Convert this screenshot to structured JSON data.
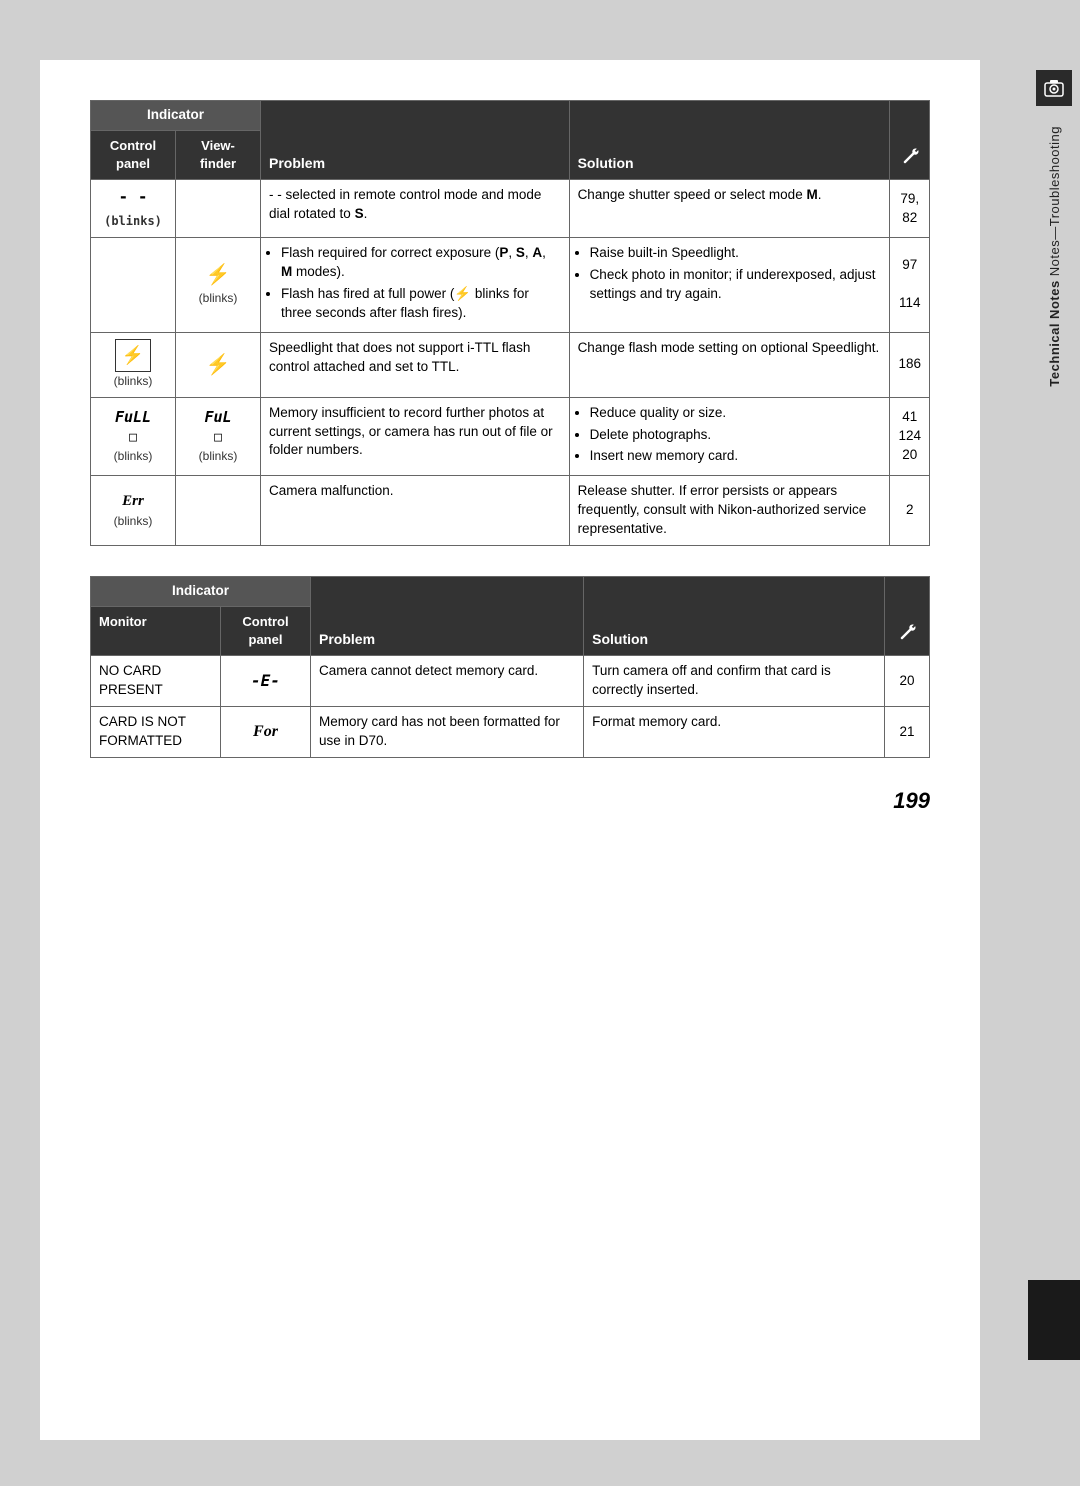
{
  "page": {
    "number": "199"
  },
  "side_tab": {
    "icon": "📷",
    "text_plain": "Technical Notes—Troubleshooting",
    "text_bold": "Technical Notes"
  },
  "table1": {
    "indicator_header": "Indicator",
    "col_headers": {
      "control_panel": "Control panel",
      "viewfinder": "View-finder",
      "problem": "Problem",
      "solution": "Solution",
      "ref_icon": "🔧"
    },
    "rows": [
      {
        "control": "- -\n(blinks)",
        "viewfinder": "",
        "problem": "- - selected in remote control mode and mode dial rotated to S.",
        "solution": "Change shutter speed or select mode M.",
        "ref": "79,\n82"
      },
      {
        "control": "",
        "viewfinder": "⚡\n(blinks)",
        "problem_bullets": [
          "Flash required for correct exposure (P, S, A, M modes).",
          "Flash has fired at full power (⚡ blinks for three seconds after flash fires)."
        ],
        "solution_bullets": [
          "Raise built-in Speedlight.",
          "Check photo in monitor; if underexposed, adjust settings and try again."
        ],
        "ref_multi": [
          "97",
          "114"
        ]
      },
      {
        "control": "⚡\n(blinks)",
        "viewfinder": "⚡",
        "problem": "Speedlight that does not support i-TTL flash control attached and set to TTL.",
        "solution": "Change flash mode setting on optional Speedlight.",
        "ref": "186"
      },
      {
        "control": "FuLL\n□\n(blinks)",
        "viewfinder": "FuL\n□\n(blinks)",
        "problem": "Memory insufficient to record further photos at current settings, or camera has run out of file or folder numbers.",
        "solution_bullets": [
          "Reduce quality or size.",
          "Delete photographs.",
          "Insert new memory card."
        ],
        "ref_multi": [
          "41",
          "124",
          "20"
        ]
      },
      {
        "control": "Err\n(blinks)",
        "viewfinder": "",
        "problem": "Camera malfunction.",
        "solution": "Release shutter. If error persists or appears frequently, consult with Nikon-authorized service representative.",
        "ref": "2"
      }
    ]
  },
  "table2": {
    "indicator_header": "Indicator",
    "col_headers": {
      "monitor": "Monitor",
      "control_panel": "Control panel",
      "problem": "Problem",
      "solution": "Solution",
      "ref_icon": "🔧"
    },
    "rows": [
      {
        "monitor": "NO CARD\nPRESENT",
        "control_panel": "-E-",
        "problem": "Camera cannot detect memory card.",
        "solution": "Turn camera off and confirm that card is correctly inserted.",
        "ref": "20"
      },
      {
        "monitor": "CARD IS NOT\nFORMATTED",
        "control_panel": "For",
        "problem": "Memory card has not been formatted for use in D70.",
        "solution": "Format memory card.",
        "ref": "21"
      }
    ]
  }
}
